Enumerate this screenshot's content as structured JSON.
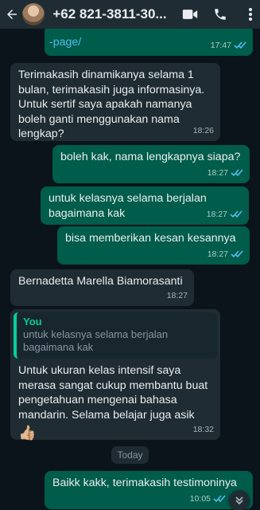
{
  "header": {
    "contact_name": "+62 821-3811-30...",
    "back_icon": "arrow-left-icon",
    "video_icon": "video-camera-icon",
    "call_icon": "phone-icon",
    "menu_icon": "more-vertical-icon"
  },
  "messages": [
    {
      "type": "out",
      "text": "-page/",
      "time": "17:47",
      "status": "read"
    },
    {
      "type": "in",
      "text": "Terimakasih dinamikanya selama 1 bulan, terimakasih juga informasinya. Untuk sertif saya apakah namanya boleh ganti menggunakan nama lengkap?",
      "time": "18:26"
    },
    {
      "type": "out",
      "text": "boleh kak, nama lengkapnya siapa?",
      "time": "18:27",
      "status": "read"
    },
    {
      "type": "out",
      "text": "untuk kelasnya selama berjalan bagaimana kak",
      "time": "18:27",
      "status": "read"
    },
    {
      "type": "out",
      "text": "bisa memberikan kesan kesannya",
      "time": "18:27",
      "status": "read"
    },
    {
      "type": "in",
      "text": "Bernadetta Marella Biamorasanti",
      "time": "18:27"
    },
    {
      "type": "in",
      "quote_name": "You",
      "quote_text": "untuk kelasnya selama berjalan bagaimana kak",
      "text": "Untuk ukuran kelas intensif saya merasa sangat cukup membantu buat pengetahuan mengenai bahasa mandarin. Selama belajar juga asik",
      "emoji": "👍🏼",
      "time": "18:32"
    },
    {
      "type": "out",
      "text": "Baikk kakk, terimakasih testimoninya",
      "time": "10:05",
      "status": "read"
    }
  ],
  "day_separator": "Today",
  "colors": {
    "background": "#0b141a",
    "incoming_bubble": "#1f2c34",
    "outgoing_bubble": "#005c4b",
    "read_ticks": "#53bdeb",
    "accent": "#06cf9c"
  }
}
